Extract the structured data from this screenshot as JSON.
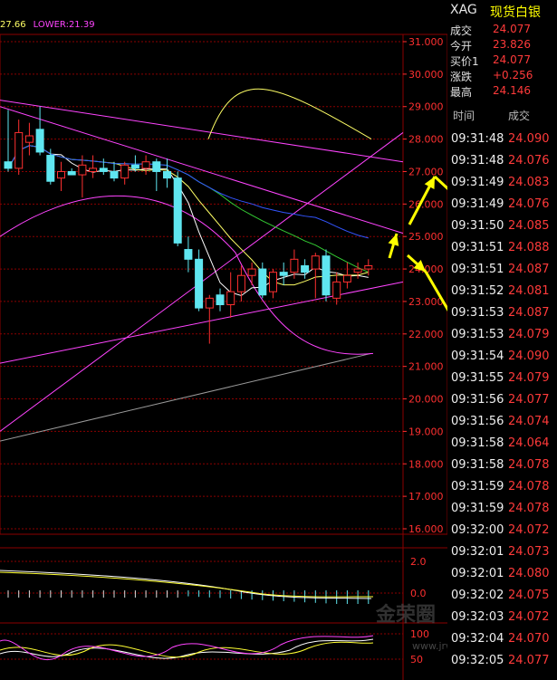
{
  "indicator_legend": {
    "upper_value": "27.66",
    "lower_label": "LOWER:21.39"
  },
  "quote": {
    "symbol": "XAG",
    "name": "现货白银",
    "rows": [
      {
        "label": "成交",
        "value": "24.077"
      },
      {
        "label": "今开",
        "value": "23.826"
      },
      {
        "label": "买价1",
        "value": "24.077"
      },
      {
        "label": "涨跌",
        "value": "+0.256"
      },
      {
        "label": "最高",
        "value": "24.146"
      }
    ]
  },
  "ticks": {
    "headers": {
      "time": "时间",
      "price": "成交"
    },
    "rows": [
      {
        "time": "09:31:48",
        "price": "24.090"
      },
      {
        "time": "09:31:48",
        "price": "24.076"
      },
      {
        "time": "09:31:49",
        "price": "24.083"
      },
      {
        "time": "09:31:49",
        "price": "24.076"
      },
      {
        "time": "09:31:50",
        "price": "24.085"
      },
      {
        "time": "09:31:51",
        "price": "24.088"
      },
      {
        "time": "09:31:51",
        "price": "24.087"
      },
      {
        "time": "09:31:52",
        "price": "24.081"
      },
      {
        "time": "09:31:53",
        "price": "24.087"
      },
      {
        "time": "09:31:53",
        "price": "24.079"
      },
      {
        "time": "09:31:54",
        "price": "24.090"
      },
      {
        "time": "09:31:55",
        "price": "24.079"
      },
      {
        "time": "09:31:56",
        "price": "24.077"
      },
      {
        "time": "09:31:56",
        "price": "24.074"
      },
      {
        "time": "09:31:58",
        "price": "24.064"
      },
      {
        "time": "09:31:58",
        "price": "24.078"
      },
      {
        "time": "09:31:59",
        "price": "24.078"
      },
      {
        "time": "09:31:59",
        "price": "24.078"
      },
      {
        "time": "09:32:00",
        "price": "24.072"
      },
      {
        "time": "09:32:01",
        "price": "24.073"
      },
      {
        "time": "09:32:01",
        "price": "24.080"
      },
      {
        "time": "09:32:02",
        "price": "24.075"
      },
      {
        "time": "09:32:03",
        "price": "24.072"
      },
      {
        "time": "09:32:04",
        "price": "24.070"
      },
      {
        "time": "09:32:05",
        "price": "24.077"
      }
    ]
  },
  "watermark": {
    "text": "金荣圈",
    "url": "www.jrwei.com"
  },
  "colors": {
    "up": "#ff3030",
    "down": "#5fe6f0",
    "grid": "#8b0000",
    "arrow": "#ffff00"
  },
  "chart_data": {
    "type": "candlestick",
    "ylim": [
      16,
      31
    ],
    "y_ticks": [
      "31.000",
      "30.000",
      "29.000",
      "28.000",
      "27.000",
      "26.000",
      "25.000",
      "24.000",
      "23.000",
      "22.000",
      "21.000",
      "20.000",
      "19.000",
      "18.000",
      "17.000",
      "16.000"
    ],
    "candles": [
      {
        "o": 27.3,
        "h": 28.9,
        "l": 27.0,
        "c": 27.1
      },
      {
        "o": 27.1,
        "h": 28.6,
        "l": 26.9,
        "c": 28.2
      },
      {
        "o": 27.9,
        "h": 28.5,
        "l": 27.5,
        "c": 28.1
      },
      {
        "o": 28.3,
        "h": 29.0,
        "l": 27.5,
        "c": 27.6
      },
      {
        "o": 27.5,
        "h": 27.7,
        "l": 26.6,
        "c": 26.7
      },
      {
        "o": 26.8,
        "h": 27.3,
        "l": 26.4,
        "c": 27.0
      },
      {
        "o": 27.0,
        "h": 27.1,
        "l": 26.9,
        "c": 26.9
      },
      {
        "o": 26.9,
        "h": 27.5,
        "l": 26.2,
        "c": 27.2
      },
      {
        "o": 27.0,
        "h": 27.5,
        "l": 26.8,
        "c": 27.1
      },
      {
        "o": 27.1,
        "h": 27.4,
        "l": 26.9,
        "c": 27.0
      },
      {
        "o": 27.0,
        "h": 27.3,
        "l": 26.7,
        "c": 26.8
      },
      {
        "o": 26.8,
        "h": 27.3,
        "l": 26.6,
        "c": 27.2
      },
      {
        "o": 27.2,
        "h": 27.5,
        "l": 27.0,
        "c": 27.1
      },
      {
        "o": 27.1,
        "h": 27.5,
        "l": 26.9,
        "c": 27.3
      },
      {
        "o": 27.3,
        "h": 27.4,
        "l": 26.4,
        "c": 27.0
      },
      {
        "o": 27.0,
        "h": 27.4,
        "l": 26.5,
        "c": 26.8
      },
      {
        "o": 26.8,
        "h": 27.0,
        "l": 24.7,
        "c": 24.8
      },
      {
        "o": 24.6,
        "h": 25.0,
        "l": 23.9,
        "c": 24.3
      },
      {
        "o": 24.3,
        "h": 24.6,
        "l": 22.7,
        "c": 22.8
      },
      {
        "o": 22.8,
        "h": 23.2,
        "l": 21.7,
        "c": 23.1
      },
      {
        "o": 23.2,
        "h": 23.4,
        "l": 22.7,
        "c": 22.9
      },
      {
        "o": 22.9,
        "h": 23.9,
        "l": 22.5,
        "c": 23.3
      },
      {
        "o": 23.3,
        "h": 24.1,
        "l": 23.0,
        "c": 23.8
      },
      {
        "o": 23.8,
        "h": 24.2,
        "l": 23.5,
        "c": 24.0
      },
      {
        "o": 24.0,
        "h": 24.2,
        "l": 23.1,
        "c": 23.2
      },
      {
        "o": 23.3,
        "h": 24.0,
        "l": 23.1,
        "c": 23.9
      },
      {
        "o": 23.9,
        "h": 24.2,
        "l": 23.5,
        "c": 23.8
      },
      {
        "o": 23.9,
        "h": 24.6,
        "l": 23.7,
        "c": 24.3
      },
      {
        "o": 24.1,
        "h": 24.3,
        "l": 23.7,
        "c": 23.9
      },
      {
        "o": 24.0,
        "h": 24.5,
        "l": 23.1,
        "c": 24.4
      },
      {
        "o": 24.4,
        "h": 24.6,
        "l": 23.0,
        "c": 23.2
      },
      {
        "o": 23.1,
        "h": 23.9,
        "l": 22.9,
        "c": 23.6
      },
      {
        "o": 23.6,
        "h": 24.2,
        "l": 23.4,
        "c": 23.8
      },
      {
        "o": 23.9,
        "h": 24.2,
        "l": 23.7,
        "c": 24.0
      },
      {
        "o": 24.0,
        "h": 24.3,
        "l": 23.8,
        "c": 24.1
      }
    ],
    "macd": {
      "y_ticks": [
        "2.0",
        "0.0"
      ]
    },
    "kdj": {
      "y_ticks": [
        "100",
        "50"
      ]
    }
  }
}
